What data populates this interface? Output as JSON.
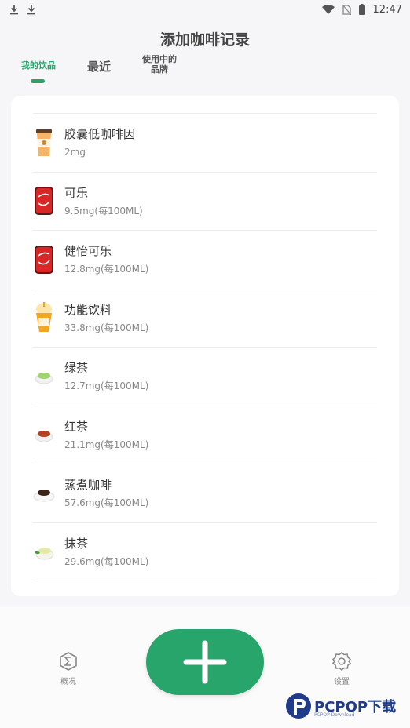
{
  "status_bar": {
    "time": "12:47",
    "left_icons": [
      "download-icon",
      "download-icon"
    ],
    "right_icons": [
      "wifi-icon",
      "no-sim-icon",
      "battery-icon"
    ]
  },
  "header": {
    "title": "添加咖啡记录"
  },
  "tabs": [
    {
      "label": "我的饮品",
      "active": true
    },
    {
      "label": "最近",
      "active": false
    },
    {
      "label": "使用中的品牌",
      "active": false
    }
  ],
  "drinks": [
    {
      "name": "胶囊低咖啡因",
      "amount": "2mg",
      "icon": "coffee-cup-icon"
    },
    {
      "name": "可乐",
      "amount": "9.5mg(每100ML)",
      "icon": "cola-can-icon"
    },
    {
      "name": "健怡可乐",
      "amount": "12.8mg(每100ML)",
      "icon": "cola-can-icon"
    },
    {
      "name": "功能饮料",
      "amount": "33.8mg(每100ML)",
      "icon": "energy-drink-icon"
    },
    {
      "name": "绿茶",
      "amount": "12.7mg(每100ML)",
      "icon": "green-tea-icon"
    },
    {
      "name": "红茶",
      "amount": "21.1mg(每100ML)",
      "icon": "black-tea-icon"
    },
    {
      "name": "蒸煮咖啡",
      "amount": "57.6mg(每100ML)",
      "icon": "brewed-coffee-icon"
    },
    {
      "name": "抹茶",
      "amount": "29.6mg(每100ML)",
      "icon": "matcha-icon"
    }
  ],
  "bottom_nav": {
    "overview_label": "概况",
    "settings_label": "设置",
    "add_icon": "plus-icon"
  },
  "watermark": {
    "brand": "PCPOP下载",
    "sub": "PCPOP Download"
  },
  "colors": {
    "accent": "#27a56b",
    "background": "#f6f6f8",
    "card": "#ffffff"
  }
}
